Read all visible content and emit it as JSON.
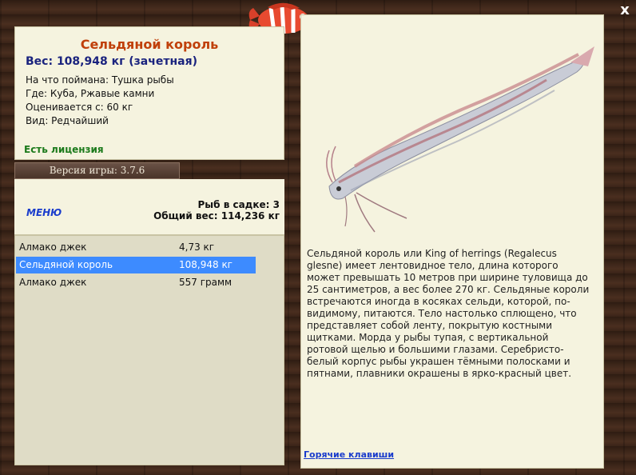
{
  "fish": {
    "title": "Сельдяной король",
    "weight": "Вес: 108,948 кг (зачетная)",
    "caught_on": "На что поймана: Тушка рыбы",
    "location": "Где: Куба, Ржавые камни",
    "value": "Оценивается с: 60 кг",
    "rarity": "Вид: Редчайший",
    "license": "Есть лицензия",
    "description": "Сельдяной король или King of herrings (Regalecus glesne) имеет лентовидное тело, длина которого может превышать 10 метров при ширине туловища до 25 сантиметров, а вес более 270 кг. Сельдяные короли встречаются иногда в косяках сельди, которой, по-видимому, питаются. Тело настолько сплющено, что представляет собой ленту, покрытую костными щитками. Морда у рыбы тупая, с вертикальной ротовой щелью и большими глазами. Серебристо-белый корпус рыбы украшен тёмными полосками и пятнами, плавники окрашены в ярко-красный цвет."
  },
  "version": "Версия игры: 3.7.6",
  "keepnet": {
    "menu_label": "МЕНЮ",
    "count": "Рыб в садке: 3",
    "total": "Общий вес: 114,236 кг",
    "items": [
      {
        "name": "Алмако джек",
        "weight": "4,73 кг"
      },
      {
        "name": "Сельдяной король",
        "weight": "108,948 кг"
      },
      {
        "name": "Алмако джек",
        "weight": "557 грамм"
      }
    ],
    "selected_index": 1
  },
  "hotkeys_label": "Горячие клавиши",
  "close_label": "x",
  "icons": {
    "close": "close-icon",
    "logo": "striped-fish-logo"
  },
  "colors": {
    "title": "#c0400a",
    "weight": "#1a237e",
    "license": "#1b7a1b",
    "selection": "#3d8bff",
    "link": "#1a3ccc",
    "panel": "#f5f3df"
  }
}
